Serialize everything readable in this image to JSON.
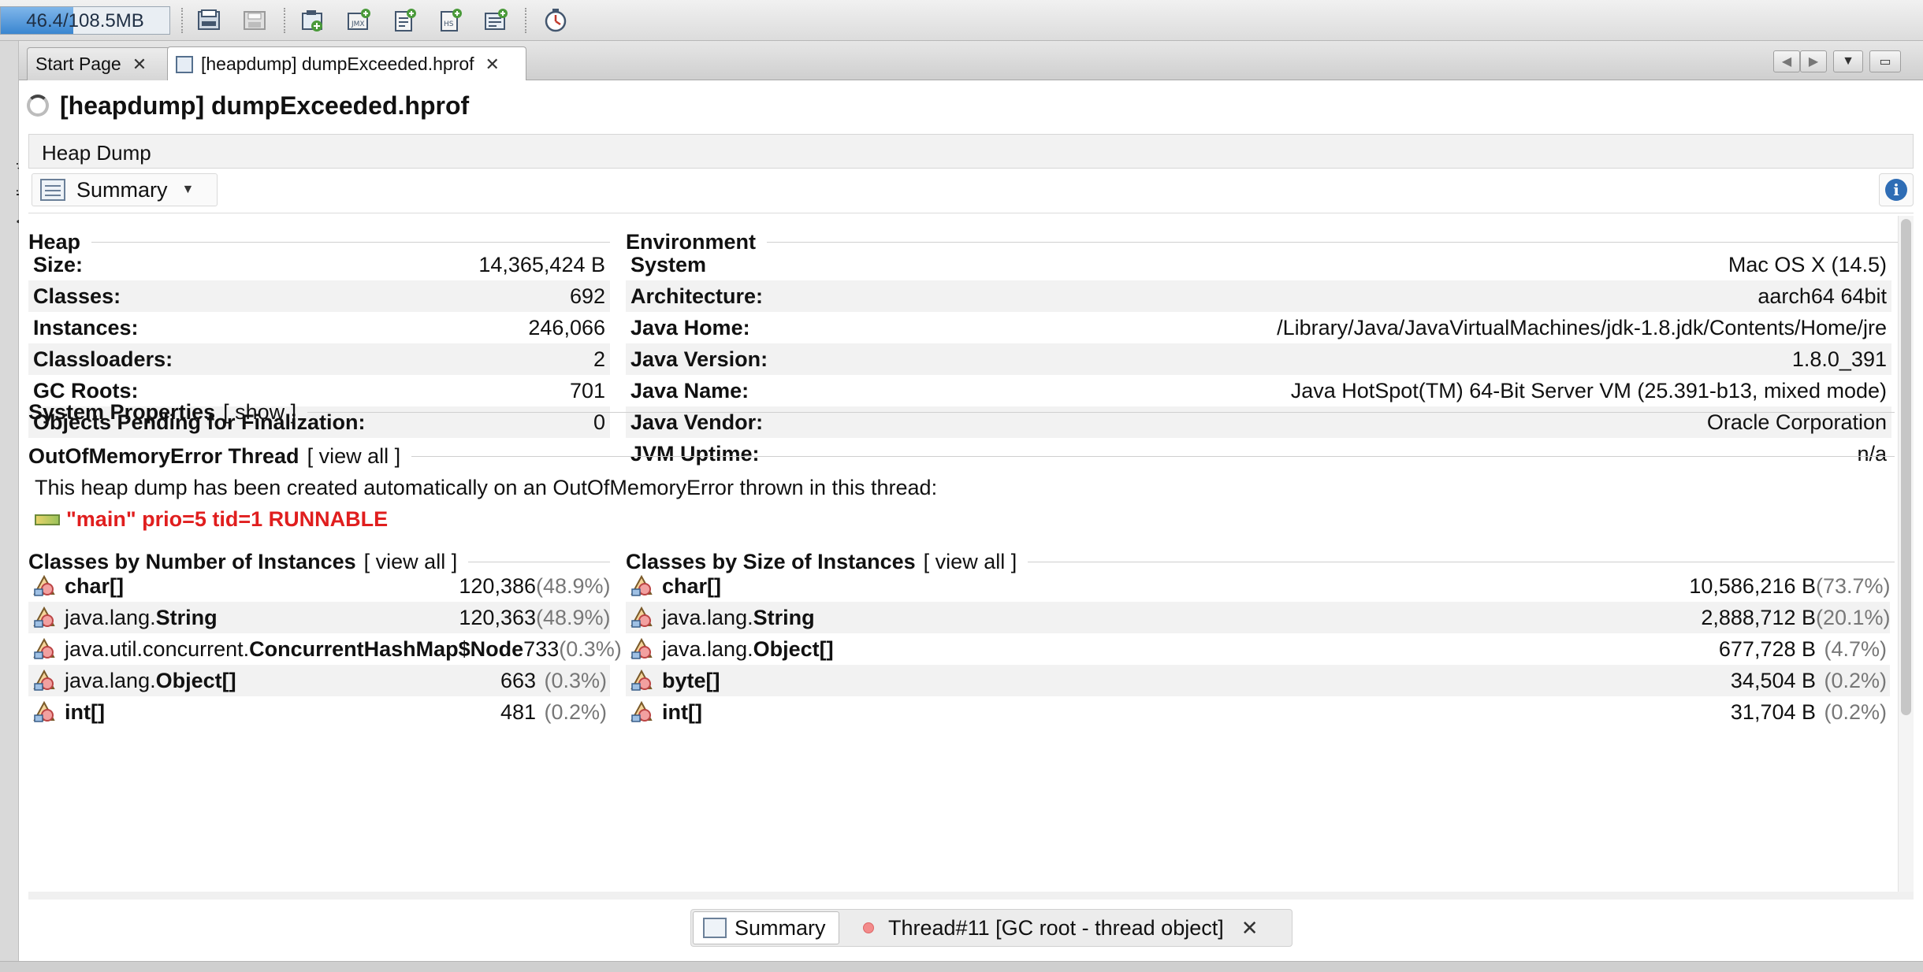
{
  "toolbar": {
    "memory_label": "46.4/108.5MB",
    "memory_fraction": 0.43,
    "icons": [
      "open-file-icon",
      "save-icon",
      "add-jmx-connection-icon",
      "add-jmx-icon",
      "add-core-dump-icon",
      "add-remote-host-icon",
      "add-snapshot-icon",
      "profiler-icon"
    ]
  },
  "leftstrip": {
    "label": "Applications"
  },
  "tabs": [
    {
      "label": "Start Page",
      "close": "✕"
    },
    {
      "label": "[heapdump] dumpExceeded.hprof",
      "close": "✕"
    }
  ],
  "document": {
    "title": "[heapdump] dumpExceeded.hprof",
    "section_header": "Heap Dump",
    "view_selector": "Summary",
    "info_icon": "i"
  },
  "heap": {
    "title": "Heap",
    "rows": [
      {
        "k": "Size:",
        "v": "14,365,424 B"
      },
      {
        "k": "Classes:",
        "v": "692"
      },
      {
        "k": "Instances:",
        "v": "246,066"
      },
      {
        "k": "Classloaders:",
        "v": "2"
      },
      {
        "k": "GC Roots:",
        "v": "701"
      },
      {
        "k": "Objects Pending for Finalization:",
        "v": "0"
      }
    ]
  },
  "environment": {
    "title": "Environment",
    "rows": [
      {
        "k": "System",
        "v": "Mac OS X (14.5)"
      },
      {
        "k": "Architecture:",
        "v": "aarch64 64bit"
      },
      {
        "k": "Java Home:",
        "v": "/Library/Java/JavaVirtualMachines/jdk-1.8.jdk/Contents/Home/jre"
      },
      {
        "k": "Java Version:",
        "v": "1.8.0_391"
      },
      {
        "k": "Java Name:",
        "v": "Java HotSpot(TM) 64-Bit Server VM (25.391-b13, mixed mode)"
      },
      {
        "k": "Java Vendor:",
        "v": "Oracle Corporation"
      },
      {
        "k": "JVM Uptime:",
        "v": "n/a"
      }
    ]
  },
  "system_properties": {
    "title": "System Properties",
    "link": "[ show ]"
  },
  "oom": {
    "title": "OutOfMemoryError Thread",
    "link": "[ view all ]",
    "text": "This heap dump has been created automatically on an OutOfMemoryError thrown in this thread:",
    "thread": "\"main\" prio=5 tid=1 RUNNABLE",
    "thread_color": "#e01e1e"
  },
  "by_instances": {
    "title": "Classes by Number of Instances",
    "link": "[ view all ]",
    "rows": [
      {
        "prefix": "",
        "name": "char[]",
        "value": "120,386",
        "pct": "(48.9%)"
      },
      {
        "prefix": "java.lang.",
        "name": "String",
        "value": "120,363",
        "pct": "(48.9%)"
      },
      {
        "prefix": "java.util.concurrent.",
        "name": "ConcurrentHashMap$Node",
        "value": "733",
        "pct": "(0.3%)"
      },
      {
        "prefix": "java.lang.",
        "name": "Object[]",
        "value": "663",
        "pct": "(0.3%)"
      },
      {
        "prefix": "",
        "name": "int[]",
        "value": "481",
        "pct": "(0.2%)"
      }
    ]
  },
  "by_size": {
    "title": "Classes by Size of Instances",
    "link": "[ view all ]",
    "rows": [
      {
        "prefix": "",
        "name": "char[]",
        "value": "10,586,216 B",
        "pct": "(73.7%)"
      },
      {
        "prefix": "java.lang.",
        "name": "String",
        "value": "2,888,712 B",
        "pct": "(20.1%)"
      },
      {
        "prefix": "java.lang.",
        "name": "Object[]",
        "value": "677,728 B",
        "pct": "(4.7%)"
      },
      {
        "prefix": "",
        "name": "byte[]",
        "value": "34,504 B",
        "pct": "(0.2%)"
      },
      {
        "prefix": "",
        "name": "int[]",
        "value": "31,704 B",
        "pct": "(0.2%)"
      }
    ]
  },
  "bottom_tabs": [
    {
      "label": "Summary"
    },
    {
      "label": "Thread#11 [GC root - thread object]",
      "close": "✕"
    }
  ]
}
